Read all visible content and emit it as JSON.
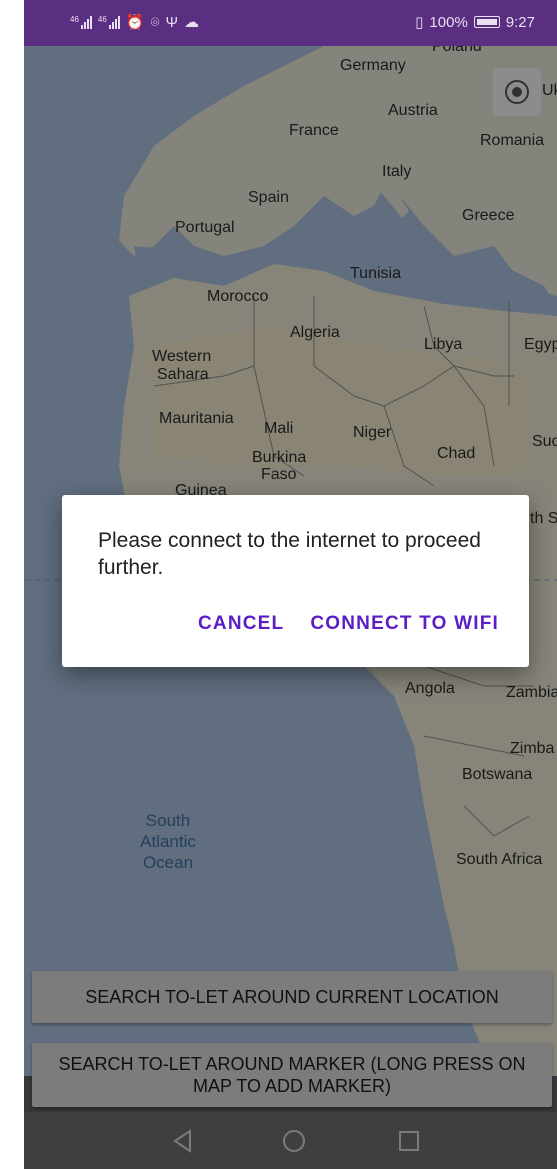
{
  "status_bar": {
    "left_signal_1": "46",
    "left_signal_2": "46",
    "battery_percent": "100%",
    "time": "9:27"
  },
  "map": {
    "labels": {
      "poland": "Poland",
      "germany": "Germany",
      "austria": "Austria",
      "france": "France",
      "romania": "Romania",
      "ukraine": "Uk",
      "italy": "Italy",
      "spain": "Spain",
      "portugal": "Portugal",
      "greece": "Greece",
      "tunisia": "Tunisia",
      "morocco": "Morocco",
      "algeria": "Algeria",
      "libya": "Libya",
      "egypt": "Egyp",
      "western_sahara_1": "Western",
      "western_sahara_2": "Sahara",
      "mauritania": "Mauritania",
      "mali": "Mali",
      "niger": "Niger",
      "chad": "Chad",
      "sudan": "Sud",
      "burkina_1": "Burkina",
      "burkina_2": "Faso",
      "guinea": "Guinea",
      "south_sudan": "th S",
      "angola": "Angola",
      "zambia": "Zambia",
      "zimbabwe": "Zimba",
      "botswana": "Botswana",
      "south_africa": "South Africa",
      "ocean_1": "South",
      "ocean_2": "Atlantic",
      "ocean_3": "Ocean"
    }
  },
  "buttons": {
    "search_current": "SEARCH TO-LET AROUND CURRENT LOCATION",
    "search_marker": "SEARCH TO-LET AROUND MARKER (LONG PRESS ON MAP TO ADD MARKER)"
  },
  "dialog": {
    "message": "Please connect to the internet to proceed further.",
    "cancel": "CANCEL",
    "connect": "CONNECT TO WIFI"
  },
  "colors": {
    "status_bar": "#5a2e80",
    "accent": "#5b1ec4"
  },
  "icons": {
    "locate": "my-location-icon",
    "nav_back": "triangle-back-icon",
    "nav_home": "circle-home-icon",
    "nav_recents": "square-recents-icon"
  }
}
